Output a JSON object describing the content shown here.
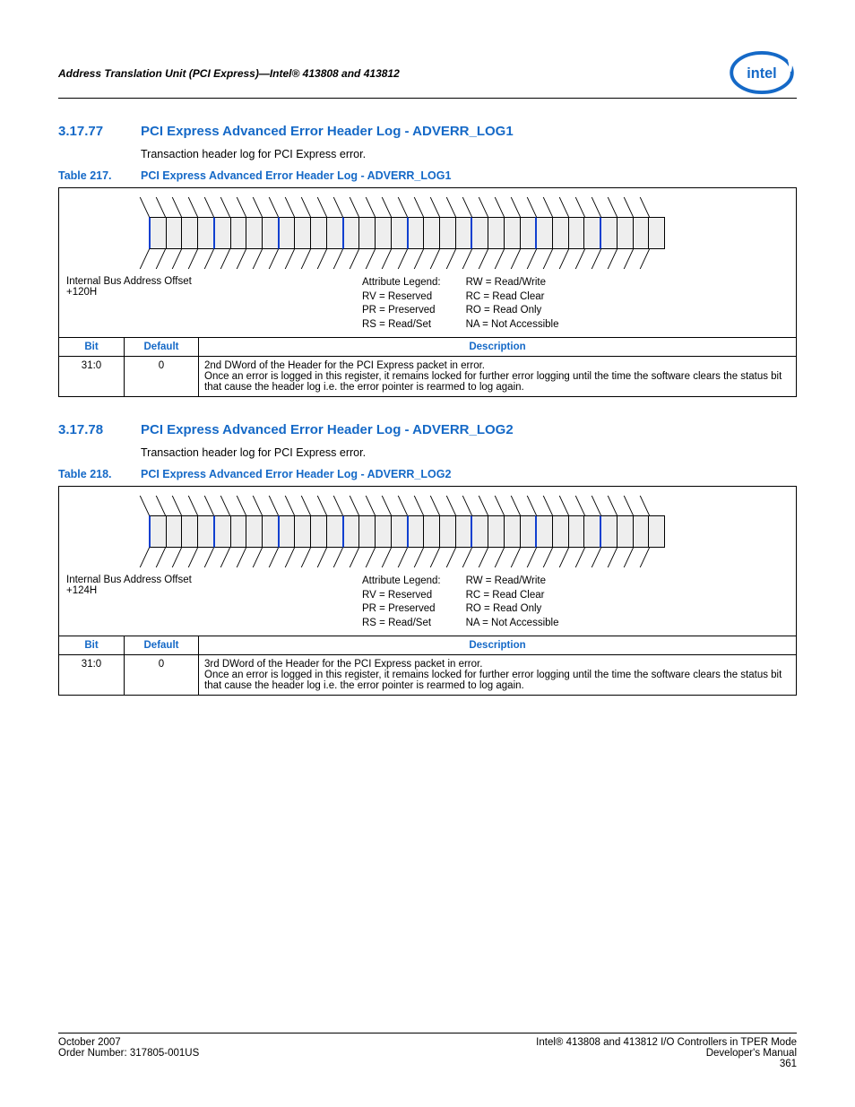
{
  "header": {
    "running_title": "Address Translation Unit (PCI Express)—Intel® 413808 and 413812"
  },
  "sections": [
    {
      "num": "3.17.77",
      "title": "PCI Express Advanced Error Header Log - ADVERR_LOG1",
      "body": "Transaction header log for PCI Express error.",
      "table_num": "Table 217.",
      "table_title": "PCI Express Advanced Error Header Log - ADVERR_LOG1",
      "offset_label": "Internal Bus Address Offset",
      "offset_value": "+120H",
      "legend_title": "Attribute Legend:",
      "legend_left": [
        "RV = Reserved",
        "PR = Preserved",
        "RS = Read/Set"
      ],
      "legend_right": [
        "RW = Read/Write",
        "RC = Read Clear",
        "RO = Read Only",
        "NA = Not Accessible"
      ],
      "cols": {
        "bit": "Bit",
        "def": "Default",
        "desc": "Description"
      },
      "row": {
        "bit": "31:0",
        "def": "0",
        "desc": "2nd DWord of the Header for the PCI Express packet in error.\nOnce an error is logged in this register, it remains locked for further error logging until the time the software clears the status bit that cause the header log i.e. the error pointer is rearmed to log again."
      }
    },
    {
      "num": "3.17.78",
      "title": "PCI Express Advanced Error Header Log - ADVERR_LOG2",
      "body": "Transaction header log for PCI Express error.",
      "table_num": "Table 218.",
      "table_title": "PCI Express Advanced Error Header Log - ADVERR_LOG2",
      "offset_label": "Internal Bus Address Offset",
      "offset_value": "+124H",
      "legend_title": "Attribute Legend:",
      "legend_left": [
        "RV = Reserved",
        "PR = Preserved",
        "RS = Read/Set"
      ],
      "legend_right": [
        "RW = Read/Write",
        "RC = Read Clear",
        "RO = Read Only",
        "NA = Not Accessible"
      ],
      "cols": {
        "bit": "Bit",
        "def": "Default",
        "desc": "Description"
      },
      "row": {
        "bit": "31:0",
        "def": "0",
        "desc": "3rd DWord of the Header for the PCI Express packet in error.\nOnce an error is logged in this register, it remains locked for further error logging until the time the software clears the status bit that cause the header log i.e. the error pointer is rearmed to log again."
      }
    }
  ],
  "footer": {
    "left1": "October 2007",
    "left2": "Order Number: 317805-001US",
    "right1": "Intel® 413808 and 413812 I/O Controllers in TPER Mode",
    "right2": "Developer's Manual",
    "page": "361"
  }
}
